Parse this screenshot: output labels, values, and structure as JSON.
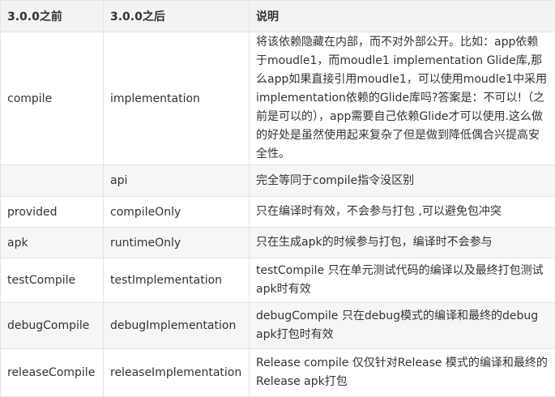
{
  "table": {
    "headers": [
      "3.0.0之前",
      "3.0.0之后",
      "说明"
    ],
    "rows": [
      {
        "before": "compile",
        "after": "implementation",
        "desc": "将该依赖隐藏在内部，而不对外部公开。比如：app依赖于moudle1，而moudle1 implementation Glide库,那么app如果直接引用moudle1，可以使用moudle1中采用implementation依赖的Glide库吗?答案是：不可以!（之前是可以的），app需要自己依赖Glide才可以使用.这么做的好处是虽然使用起来复杂了但是做到降低偶合兴提高安全性。"
      },
      {
        "before": "",
        "after": "api",
        "desc": "完全等同于compile指令没区别"
      },
      {
        "before": "provided",
        "after": "compileOnly",
        "desc": "只在编译时有效，不会参与打包 ,可以避免包冲突"
      },
      {
        "before": "apk",
        "after": "runtimeOnly",
        "desc": "只在生成apk的时候参与打包，编译时不会参与"
      },
      {
        "before": "testCompile",
        "after": "testImplementation",
        "desc": "testCompile 只在单元测试代码的编译以及最终打包测试apk时有效"
      },
      {
        "before": "debugCompile",
        "after": "debugImplementation",
        "desc": "debugCompile 只在debug模式的编译和最终的debug apk打包时有效"
      },
      {
        "before": "releaseCompile",
        "after": "releaseImplementation",
        "desc": "Release compile 仅仅针对Release 模式的编译和最终的Release apk打包"
      }
    ]
  }
}
